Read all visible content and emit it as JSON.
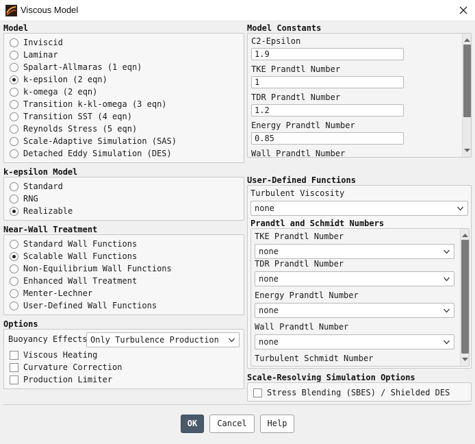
{
  "window": {
    "title": "Viscous Model",
    "icon": "fluent-app-icon"
  },
  "model": {
    "label": "Model",
    "options": [
      {
        "label": "Inviscid",
        "selected": false
      },
      {
        "label": "Laminar",
        "selected": false
      },
      {
        "label": "Spalart-Allmaras (1 eqn)",
        "selected": false
      },
      {
        "label": "k-epsilon (2 eqn)",
        "selected": true
      },
      {
        "label": "k-omega (2 eqn)",
        "selected": false
      },
      {
        "label": "Transition k-kl-omega (3 eqn)",
        "selected": false
      },
      {
        "label": "Transition SST (4 eqn)",
        "selected": false
      },
      {
        "label": "Reynolds Stress (5 eqn)",
        "selected": false
      },
      {
        "label": "Scale-Adaptive Simulation (SAS)",
        "selected": false
      },
      {
        "label": "Detached Eddy Simulation (DES)",
        "selected": false
      }
    ]
  },
  "ke_model": {
    "label": "k-epsilon Model",
    "options": [
      {
        "label": "Standard",
        "selected": false
      },
      {
        "label": "RNG",
        "selected": false
      },
      {
        "label": "Realizable",
        "selected": true
      }
    ]
  },
  "near_wall": {
    "label": "Near-Wall Treatment",
    "options": [
      {
        "label": "Standard Wall Functions",
        "selected": false
      },
      {
        "label": "Scalable Wall Functions",
        "selected": true
      },
      {
        "label": "Non-Equilibrium Wall Functions",
        "selected": false
      },
      {
        "label": "Enhanced Wall Treatment",
        "selected": false
      },
      {
        "label": "Menter-Lechner",
        "selected": false
      },
      {
        "label": "User-Defined Wall Functions",
        "selected": false
      }
    ]
  },
  "options": {
    "label": "Options",
    "buoyancy_label": "Buoyancy Effects",
    "buoyancy_value": "Only Turbulence Production",
    "checks": [
      {
        "label": "Viscous Heating",
        "checked": false
      },
      {
        "label": "Curvature Correction",
        "checked": false
      },
      {
        "label": "Production Limiter",
        "checked": false
      }
    ]
  },
  "constants": {
    "label": "Model Constants",
    "fields": [
      {
        "label": "C2-Epsilon",
        "value": "1.9"
      },
      {
        "label": "TKE Prandtl Number",
        "value": "1"
      },
      {
        "label": "TDR Prandtl Number",
        "value": "1.2"
      },
      {
        "label": "Energy Prandtl Number",
        "value": "0.85"
      },
      {
        "label": "Wall Prandtl Number",
        "value": ""
      }
    ],
    "scroll_position": 0.0
  },
  "udf": {
    "label": "User-Defined Functions",
    "turb_visc_label": "Turbulent Viscosity",
    "turb_visc_value": "none",
    "prandtl_label": "Prandtl and Schmidt Numbers",
    "fields": [
      {
        "label": "TKE Prandtl Number",
        "value": "none"
      },
      {
        "label": "TDR Prandtl Number",
        "value": "none"
      },
      {
        "label": "Energy Prandtl Number",
        "value": "none"
      },
      {
        "label": "Wall Prandtl Number",
        "value": "none"
      },
      {
        "label": "Turbulent Schmidt Number",
        "value": ""
      }
    ]
  },
  "srs": {
    "label": "Scale-Resolving Simulation Options",
    "check_label": "Stress Blending (SBES) / Shielded DES",
    "checked": false
  },
  "buttons": {
    "ok": "OK",
    "cancel": "Cancel",
    "help": "Help"
  },
  "colors": {
    "primary_button": "#4a5a6a",
    "scroll_thumb": "#7a7a7a"
  }
}
